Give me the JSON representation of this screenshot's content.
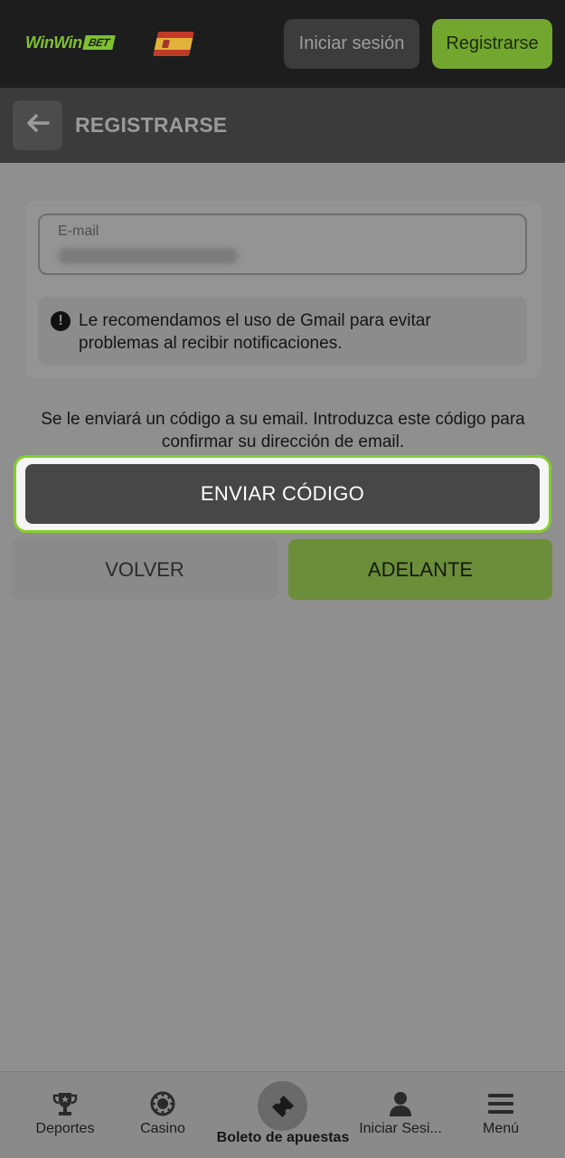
{
  "header": {
    "logo": {
      "part1": "Win",
      "part2": "Win",
      "part3": "BET"
    },
    "flag_icon": "spain-flag-icon",
    "login_label": "Iniciar sesión",
    "register_label": "Registrarse"
  },
  "titlebar": {
    "back_icon": "arrow-left-icon",
    "title": "REGISTRARSE"
  },
  "form": {
    "email_label": "E-mail",
    "email_value": "",
    "note_icon": "exclamation-circle-icon",
    "note_text": "Le recomendamos el uso de Gmail para evitar problemas al recibir notificaciones."
  },
  "info_text": "Se le enviará un código a su email. Introduzca este código para confirmar su dirección de email.",
  "buttons": {
    "send_code": "ENVIAR CÓDIGO",
    "back": "VOLVER",
    "next": "ADELANTE"
  },
  "bottom_nav": {
    "items": [
      {
        "label": "Deportes",
        "icon": "trophy-icon"
      },
      {
        "label": "Casino",
        "icon": "casino-chip-icon"
      },
      {
        "label": "Boleto de apuestas",
        "icon": "ticket-icon"
      },
      {
        "label": "Iniciar Sesi...",
        "icon": "user-icon"
      },
      {
        "label": "Menú",
        "icon": "hamburger-menu-icon"
      }
    ]
  },
  "colors": {
    "brand_green": "#7fc031",
    "highlight_outline": "#86cc2f",
    "header_bg": "#1d1d1d",
    "overlay_bg": "#8f8f8f"
  }
}
